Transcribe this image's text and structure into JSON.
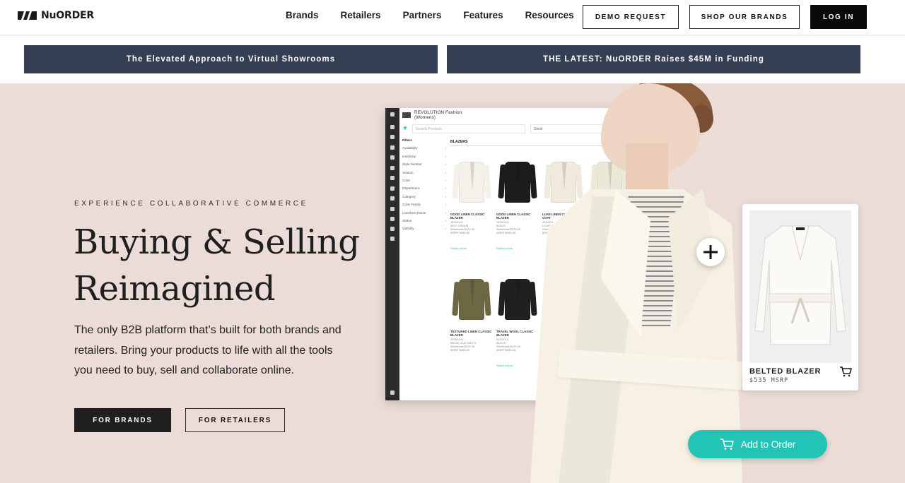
{
  "nav": {
    "logo_text": "NuORDER",
    "links": [
      "Brands",
      "Retailers",
      "Partners",
      "Features",
      "Resources"
    ],
    "demo_label": "DEMO REQUEST",
    "shop_label": "SHOP OUR BRANDS",
    "login_label": "LOG IN"
  },
  "banners": {
    "left": "The Elevated Approach to Virtual Showrooms",
    "right": "THE LATEST: NuORDER Raises $45M in Funding"
  },
  "hero": {
    "eyebrow": "EXPERIENCE COLLABORATIVE COMMERCE",
    "headline_1": "Buying & Selling",
    "headline_2": "Reimagined",
    "subtext": "The only B2B platform that’s built for both brands and retailers. Bring your products to life with all the tools you need to buy, sell and collaborate online.",
    "btn_brands": "FOR BRANDS",
    "btn_retailers": "FOR RETAILERS"
  },
  "app_mockup": {
    "title_1": "REVOLUTION Fashion",
    "title_2": "(Womens)",
    "search_placeholder": "Search Products",
    "sort_label": "Stock",
    "filters_title": "Filters",
    "filters": [
      "Availability",
      "Inventory",
      "Style Number",
      "Season",
      "Color",
      "Department",
      "Category",
      "Color Family",
      "Linesheet Name",
      "Status",
      "Visibility"
    ],
    "category": "BLAZERS",
    "products": [
      {
        "name": "GOOD LINEN CLASSIC BLAZER",
        "code": "JE000101",
        "color": "MIST CREAM",
        "wholesale": "$225.00",
        "msrp": "$495.00",
        "fill": "#f3f1ea",
        "link": "Select colors"
      },
      {
        "name": "GOOD LINEN CLASSIC BLAZER",
        "code": "JE000101",
        "color": "BLACK",
        "wholesale": "$225.00",
        "msrp": "$495.00",
        "fill": "#1c1c1c",
        "link": "Select colors"
      },
      {
        "name": "LUXE LINEN OVERLAY COAT",
        "code": "JE00901",
        "color": "LIGHT LINEN",
        "wholesale": "$245.00",
        "msrp": "$535.00",
        "fill": "#efeadc",
        "link": ""
      },
      {
        "name": "",
        "code": "",
        "color": "",
        "wholesale": "",
        "msrp": "",
        "fill": "#ece8d7",
        "link": ""
      },
      {
        "name": "TEXTURED LINEN CLASSIC BLAZER",
        "code": "JE000104",
        "color": "BEIGE CLAY MULTI",
        "wholesale": "$225.00",
        "msrp": "$495.00",
        "fill": "#6e6744",
        "link": ""
      },
      {
        "name": "TRAVEL WOOL CLASSIC BLAZER",
        "code": "01925101",
        "color": "BLACK",
        "wholesale": "$270.00",
        "msrp": "$595.00",
        "fill": "#202020",
        "link": "Select colors"
      },
      {
        "name": "TRAVE BLAZE",
        "code": "01925",
        "color": "DOE",
        "wholesale": "",
        "msrp": "",
        "fill": "#c59a6a",
        "link": ""
      }
    ]
  },
  "product_card": {
    "name": "BELTED BLAZER",
    "price": "$535 MSRP"
  },
  "add_to_order": "Add to Order",
  "colors": {
    "banner": "#353f54",
    "hero_bg": "#ebdcd7",
    "accent_teal": "#22c4b6"
  }
}
